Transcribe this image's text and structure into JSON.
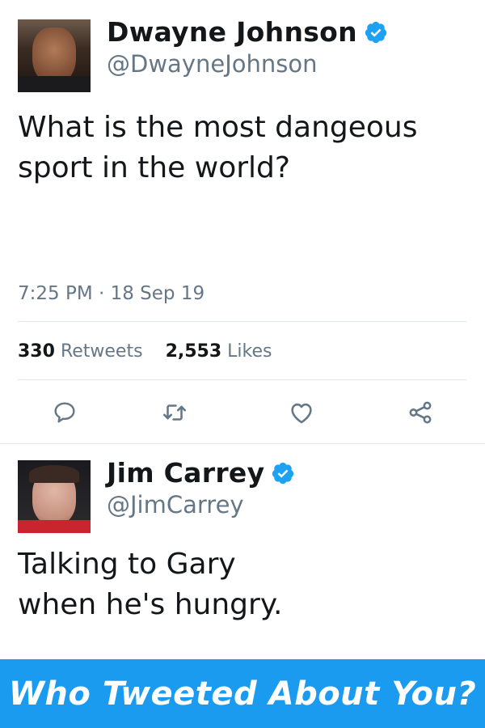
{
  "tweet1": {
    "author_name": "Dwayne Johnson",
    "handle": "@DwayneJohnson",
    "text": "What is the most dangeous sport in the world?",
    "timestamp": "7:25 PM · 18 Sep 19",
    "retweets_count": "330",
    "retweets_label": "Retweets",
    "likes_count": "2,553",
    "likes_label": "Likes"
  },
  "tweet2": {
    "author_name": "Jim Carrey",
    "handle": "@JimCarrey",
    "text": "Talking to Gary when he's hungry."
  },
  "banner": {
    "text": "Who Tweeted About You?"
  },
  "colors": {
    "accent": "#1a9bf0",
    "muted_text": "#657786",
    "divider": "#e1e8ed"
  }
}
